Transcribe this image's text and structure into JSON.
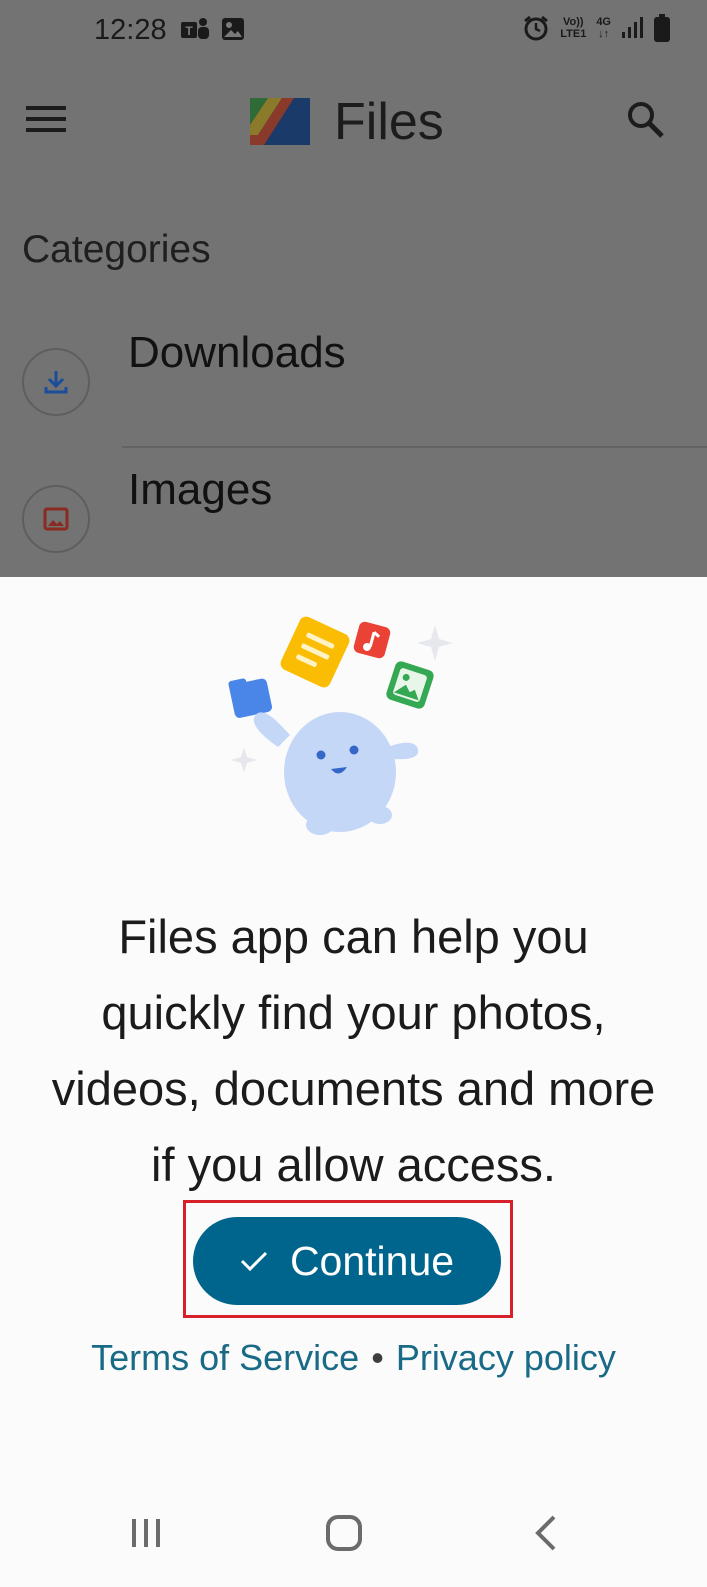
{
  "status_bar": {
    "time": "12:28",
    "icons_left": [
      "teams-icon",
      "image-icon"
    ],
    "icons_right": [
      "alarm-icon",
      "volte-icon",
      "4g-icon",
      "signal-icon",
      "battery-icon"
    ],
    "volte_line1": "Vo))",
    "volte_line2": "LTE1",
    "net_line1": "4G",
    "net_line2": "↓↑"
  },
  "app_bar": {
    "title": "Files",
    "menu_icon": "hamburger-menu-icon",
    "logo_icon": "files-logo-icon",
    "search_icon": "search-icon"
  },
  "categories": {
    "heading": "Categories",
    "items": [
      {
        "label": "Downloads",
        "icon": "download-icon"
      },
      {
        "label": "Images",
        "icon": "image-icon"
      }
    ]
  },
  "sheet": {
    "illustration": "files-mascot-illustration",
    "message": "Files app can help you quickly find your photos, videos, documents and more if you allow access.",
    "continue_label": "Continue",
    "continue_icon": "check-icon",
    "terms_label": "Terms of Service",
    "separator": "•",
    "privacy_label": "Privacy policy"
  },
  "navigation_bar": {
    "recents_icon": "recents-icon",
    "home_icon": "home-icon",
    "back_icon": "back-icon"
  },
  "colors": {
    "accent": "#00658c",
    "link": "#186a86",
    "highlight": "#d6202a",
    "dim_overlay": "#737373"
  }
}
